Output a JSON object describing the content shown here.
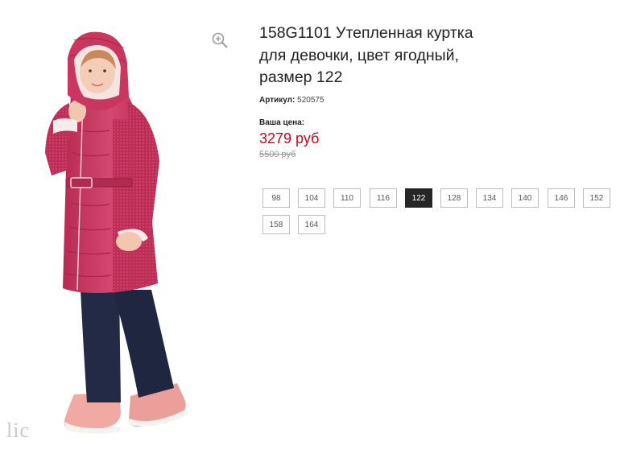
{
  "product": {
    "title": "158G1101 Утепленная куртка для девочки, цвет ягодный, размер 122",
    "sku_label": "Артикул:",
    "sku_value": "520575",
    "price_label": "Ваша цена:",
    "price": "3279 руб",
    "old_price": "5500 руб"
  },
  "sizes": {
    "selected": "122",
    "options": [
      "98",
      "104",
      "110",
      "116",
      "122",
      "128",
      "134",
      "140",
      "146",
      "152",
      "158",
      "164"
    ]
  },
  "image": {
    "watermark": "lic",
    "zoom_icon": "zoom-in-icon"
  },
  "colors": {
    "price": "#d0021b",
    "selected_size_bg": "#262626",
    "jacket": "#c2325a"
  }
}
